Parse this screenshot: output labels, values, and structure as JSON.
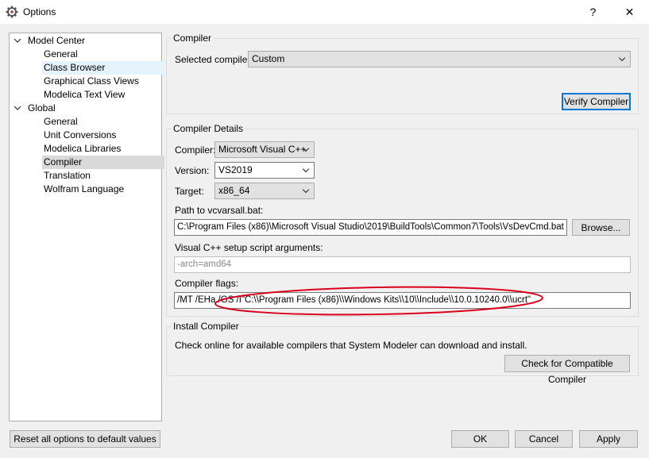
{
  "window": {
    "title": "Options",
    "help_glyph": "?",
    "close_glyph": "✕"
  },
  "tree": {
    "groups": [
      {
        "label": "Model Center",
        "items": [
          "General",
          "Class Browser",
          "Graphical Class Views",
          "Modelica Text View"
        ]
      },
      {
        "label": "Global",
        "items": [
          "General",
          "Unit Conversions",
          "Modelica Libraries",
          "Compiler",
          "Translation",
          "Wolfram Language"
        ]
      }
    ]
  },
  "compiler_section": {
    "title": "Compiler",
    "selected_label": "Selected compiler:",
    "selected_value": "Custom",
    "verify_button": "Verify Compiler"
  },
  "details_section": {
    "title": "Compiler Details",
    "compiler_label": "Compiler:",
    "compiler_value": "Microsoft Visual C++",
    "version_label": "Version:",
    "version_value": "VS2019",
    "target_label": "Target:",
    "target_value": "x86_64",
    "path_label": "Path to vcvarsall.bat:",
    "path_value": "C:\\Program Files (x86)\\Microsoft Visual Studio\\2019\\BuildTools\\Common7\\Tools\\VsDevCmd.bat",
    "browse_button": "Browse...",
    "script_args_label": "Visual C++ setup script arguments:",
    "script_args_value": "-arch=amd64",
    "flags_label": "Compiler flags:",
    "flags_value": "/MT /EHa /GS /I\"C:\\\\Program Files (x86)\\\\Windows Kits\\\\10\\\\Include\\\\10.0.10240.0\\\\ucrt\""
  },
  "install_section": {
    "title": "Install Compiler",
    "description": "Check online for available compilers that System Modeler can download and install.",
    "check_button": "Check for Compatible Compiler"
  },
  "footer": {
    "reset_button": "Reset all options to default values",
    "ok_button": "OK",
    "cancel_button": "Cancel",
    "apply_button": "Apply"
  },
  "colors": {
    "annotation_ellipse": "#d9001b",
    "selection_light": "#e5f3ff",
    "selection": "#d9d9d9",
    "default_button_border": "#0078d7"
  }
}
